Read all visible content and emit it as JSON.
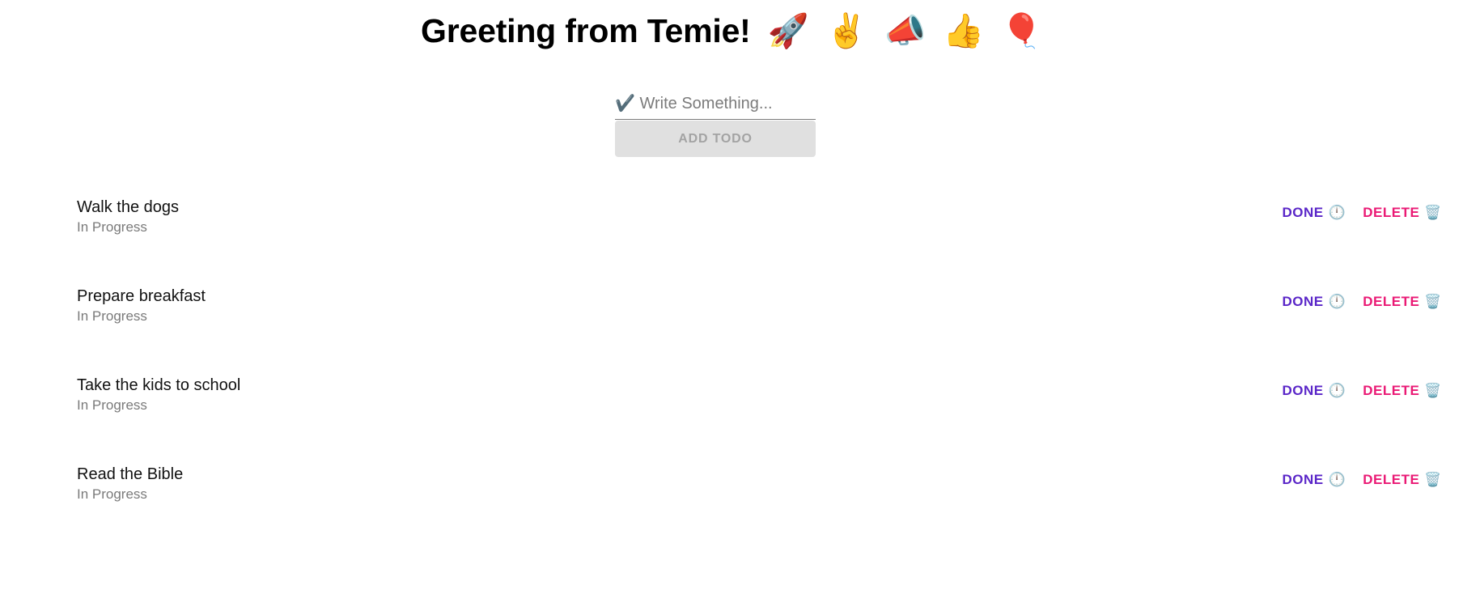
{
  "header": {
    "title": "Greeting from Temie!",
    "emojis": [
      "🚀",
      "✌️",
      "📣",
      "👍",
      "🎈"
    ],
    "emoji_names": [
      "rocket-icon",
      "victory-hand-icon",
      "megaphone-icon",
      "thumbs-up-icon",
      "balloon-icon"
    ]
  },
  "form": {
    "placeholder": "✔️ Write Something...",
    "value": "",
    "add_label": "ADD TODO"
  },
  "todos": [
    {
      "title": "Walk the dogs",
      "status": "In Progress",
      "done_label": "DONE",
      "done_icon": "🕛",
      "delete_label": "DELETE",
      "delete_icon": "🗑️"
    },
    {
      "title": "Prepare breakfast",
      "status": "In Progress",
      "done_label": "DONE",
      "done_icon": "🕛",
      "delete_label": "DELETE",
      "delete_icon": "🗑️"
    },
    {
      "title": "Take the kids to school",
      "status": "In Progress",
      "done_label": "DONE",
      "done_icon": "🕛",
      "delete_label": "DELETE",
      "delete_icon": "🗑️"
    },
    {
      "title": "Read the Bible",
      "status": "In Progress",
      "done_label": "DONE",
      "done_icon": "🕛",
      "delete_label": "DELETE",
      "delete_icon": "🗑️"
    }
  ],
  "colors": {
    "done": "#5a26c8",
    "delete": "#ea1a75",
    "button_bg": "#e0e0e0",
    "button_text": "#a3a3a3",
    "status_text": "#7a7a7a"
  },
  "icons": {
    "done": "clock-icon",
    "delete": "trash-icon"
  }
}
